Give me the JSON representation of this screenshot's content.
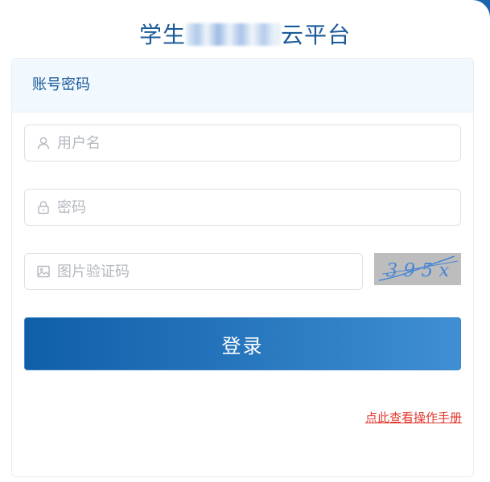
{
  "header": {
    "title_prefix": "学生",
    "title_suffix": "云平台"
  },
  "tabs": [
    {
      "label": "账号密码"
    }
  ],
  "form": {
    "username": {
      "placeholder": "用户名",
      "icon": "user-icon"
    },
    "password": {
      "placeholder": "密码",
      "icon": "lock-icon"
    },
    "captcha_input": {
      "placeholder": "图片验证码",
      "icon": "image-icon"
    },
    "captcha_image": {
      "text": "3 9 5 x"
    }
  },
  "login_button": {
    "label": "登录"
  },
  "manual_link": {
    "label": "点此查看操作手册"
  },
  "colors": {
    "brand": "#1a5a9a",
    "button_start": "#0f5ea8",
    "button_end": "#3f8fd2",
    "link": "#e0392f"
  }
}
